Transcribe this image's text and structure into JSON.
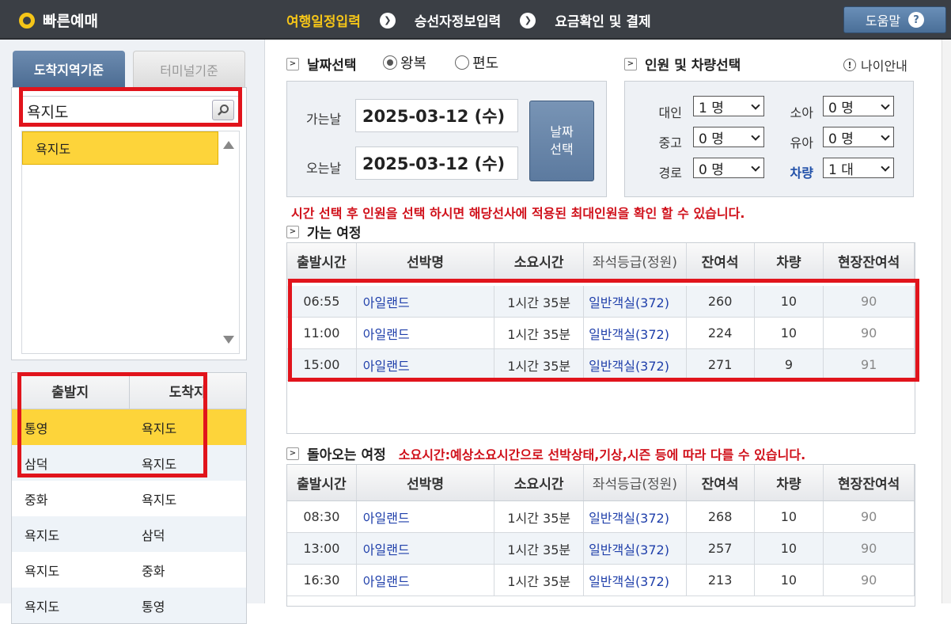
{
  "header": {
    "app_title": "빠른예매",
    "steps": [
      "여행일정입력",
      "승선자정보입력",
      "요금확인 및 결제"
    ],
    "step_arrow": "❯",
    "help_label": "도움말",
    "help_icon": "?"
  },
  "left": {
    "tabs": [
      "도착지역기준",
      "터미널기준"
    ],
    "search": {
      "value": "욕지도",
      "placeholder": ""
    },
    "region_list": [
      "욕지도"
    ],
    "route_headers": [
      "출발지",
      "도착지"
    ],
    "routes": [
      {
        "from": "통영",
        "to": "욕지도"
      },
      {
        "from": "삼덕",
        "to": "욕지도"
      },
      {
        "from": "중화",
        "to": "욕지도"
      },
      {
        "from": "욕지도",
        "to": "삼덕"
      },
      {
        "from": "욕지도",
        "to": "중화"
      },
      {
        "from": "욕지도",
        "to": "통영"
      }
    ]
  },
  "date_section": {
    "title": "날짜선택",
    "trip_types": [
      "왕복",
      "편도"
    ],
    "selected_trip": "왕복",
    "go_label": "가는날",
    "go_date": "2025-03-12 (수)",
    "return_label": "오는날",
    "return_date": "2025-03-12 (수)",
    "select_button": [
      "날짜",
      "선택"
    ]
  },
  "people_section": {
    "title": "인원 및 차량선택",
    "age_info": "나이안내",
    "age_icon": "!",
    "fields": [
      {
        "label": "대인",
        "value": "1 명"
      },
      {
        "label": "소아",
        "value": "0 명"
      },
      {
        "label": "중고",
        "value": "0 명"
      },
      {
        "label": "유아",
        "value": "0 명"
      },
      {
        "label": "경로",
        "value": "0 명"
      },
      {
        "label": "차량",
        "value": "1 대"
      }
    ]
  },
  "notice": "시간 선택 후 인원을 선택 하시면 해당선사에 적용된 최대인원을 확인 할 수 있습니다.",
  "outbound": {
    "title": "가는 여정",
    "headers": [
      "출발시간",
      "선박명",
      "소요시간",
      "좌석등급(정원)",
      "잔여석",
      "차량",
      "현장잔여석"
    ],
    "rows": [
      [
        "06:55",
        "아일랜드",
        "1시간 35분",
        "일반객실(372)",
        "260",
        "10",
        "90"
      ],
      [
        "11:00",
        "아일랜드",
        "1시간 35분",
        "일반객실(372)",
        "224",
        "10",
        "90"
      ],
      [
        "15:00",
        "아일랜드",
        "1시간 35분",
        "일반객실(372)",
        "271",
        "9",
        "91"
      ]
    ]
  },
  "inbound": {
    "title": "돌아오는 여정",
    "note": "소요시간:예상소요시간으로 선박상태,기상,시즌 등에 따라 다를 수 있습니다.",
    "headers": [
      "출발시간",
      "선박명",
      "소요시간",
      "좌석등급(정원)",
      "잔여석",
      "차량",
      "현장잔여석"
    ],
    "rows": [
      [
        "08:30",
        "아일랜드",
        "1시간 35분",
        "일반객실(372)",
        "268",
        "10",
        "90"
      ],
      [
        "13:00",
        "아일랜드",
        "1시간 35분",
        "일반객실(372)",
        "257",
        "10",
        "90"
      ],
      [
        "16:30",
        "아일랜드",
        "1시간 35분",
        "일반객실(372)",
        "213",
        "10",
        "90"
      ]
    ]
  },
  "colors": {
    "accent_yellow": "#f5c518",
    "highlight_red": "#e1141c",
    "notice_red": "#d0101a",
    "link_blue": "#1f3faa"
  }
}
